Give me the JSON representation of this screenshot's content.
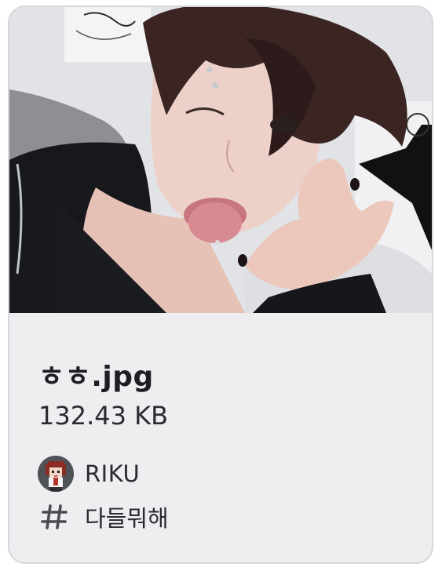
{
  "attachment": {
    "file_name": "ㅎㅎ.jpg",
    "file_size": "132.43 KB",
    "image_icon": "photo-thumbnail"
  },
  "author": {
    "name": "RIKU",
    "avatar_icon": "avatar-pixel-art"
  },
  "channel": {
    "name": "다들뭐해",
    "icon": "hash-icon"
  },
  "colors": {
    "card_background": "#eeeef1",
    "card_border": "#d6d7db",
    "text_primary": "#1d1e22"
  }
}
